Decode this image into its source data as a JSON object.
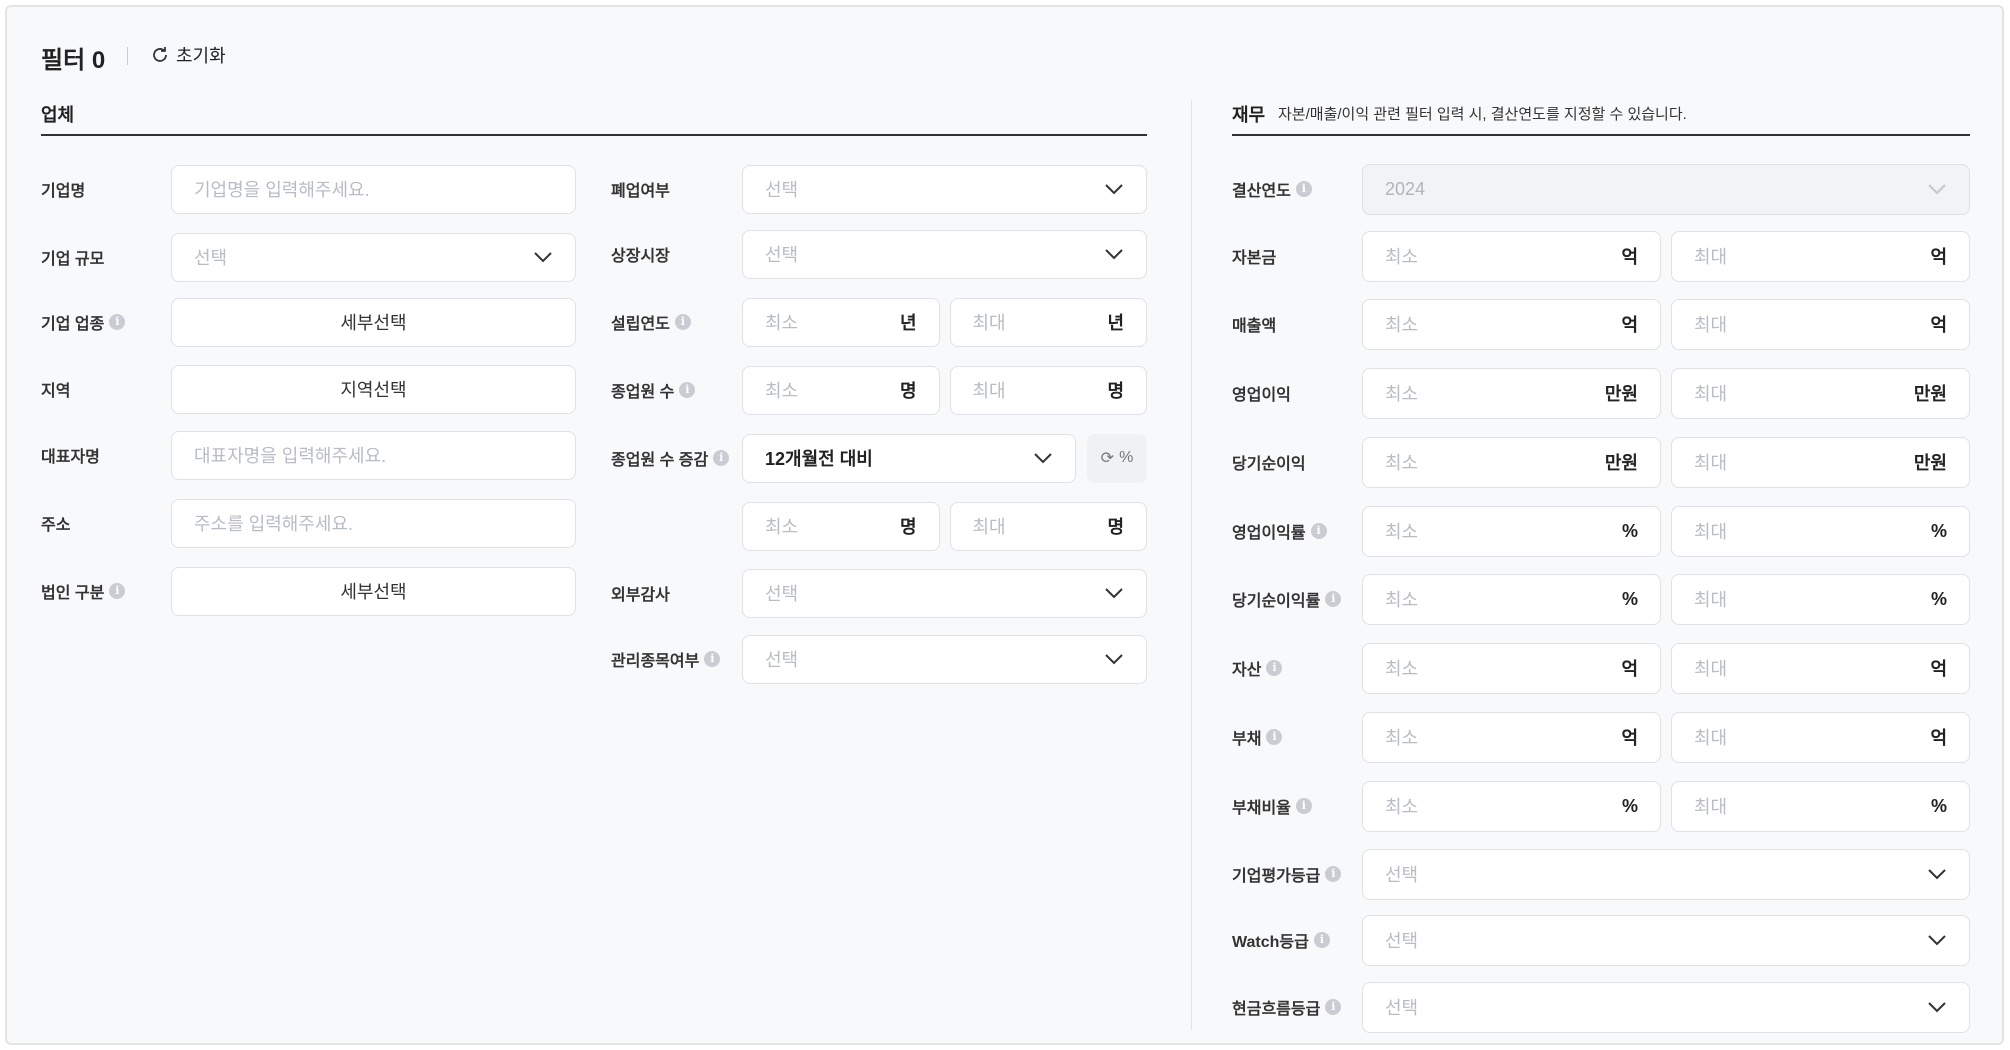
{
  "header": {
    "title": "필터 0",
    "reset_label": "초기화"
  },
  "company": {
    "title": "업체",
    "left_rows": [
      {
        "label": "기업명",
        "type": "text",
        "placeholder": "기업명을 입력해주세요."
      },
      {
        "label": "기업 규모",
        "type": "select",
        "placeholder": "선택"
      },
      {
        "label": "기업 업종",
        "info": true,
        "type": "button",
        "text": "세부선택"
      },
      {
        "label": "지역",
        "type": "button",
        "text": "지역선택"
      },
      {
        "label": "대표자명",
        "type": "text",
        "placeholder": "대표자명을 입력해주세요."
      },
      {
        "label": "주소",
        "type": "text",
        "placeholder": "주소를 입력해주세요."
      },
      {
        "label": "법인 구분",
        "info": true,
        "type": "button",
        "text": "세부선택"
      }
    ],
    "mid_rows": [
      {
        "label": "폐업여부",
        "type": "select",
        "placeholder": "선택"
      },
      {
        "label": "상장시장",
        "type": "select",
        "placeholder": "선택"
      },
      {
        "label": "설립연도",
        "info": true,
        "type": "range",
        "min": "최소",
        "max": "최대",
        "unit": "년"
      },
      {
        "label": "종업원 수",
        "info": true,
        "type": "range",
        "min": "최소",
        "max": "최대",
        "unit": "명"
      },
      {
        "label": "종업원 수 증감",
        "info": true,
        "type": "selectpct",
        "value": "12개월전 대비",
        "toggle": "%"
      },
      {
        "label": "",
        "type": "range",
        "min": "최소",
        "max": "최대",
        "unit": "명"
      },
      {
        "label": "외부감사",
        "type": "select",
        "placeholder": "선택"
      },
      {
        "label": "관리종목여부",
        "info": true,
        "type": "select",
        "placeholder": "선택"
      }
    ]
  },
  "finance": {
    "title": "재무",
    "note": "자본/매출/이익 관련 필터 입력 시, 결산연도를 지정할 수 있습니다.",
    "rows": [
      {
        "label": "결산연도",
        "info": true,
        "type": "disabled",
        "placeholder": "2024"
      },
      {
        "label": "자본금",
        "type": "range",
        "min": "최소",
        "max": "최대",
        "unit": "억"
      },
      {
        "label": "매출액",
        "type": "range",
        "min": "최소",
        "max": "최대",
        "unit": "억"
      },
      {
        "label": "영업이익",
        "type": "range",
        "min": "최소",
        "max": "최대",
        "unit": "만원"
      },
      {
        "label": "당기순이익",
        "type": "range",
        "min": "최소",
        "max": "최대",
        "unit": "만원"
      },
      {
        "label": "영업이익률",
        "info": true,
        "type": "range",
        "min": "최소",
        "max": "최대",
        "unit": "%"
      },
      {
        "label": "당기순이익률",
        "info": true,
        "type": "range",
        "min": "최소",
        "max": "최대",
        "unit": "%"
      },
      {
        "label": "자산",
        "info": true,
        "type": "range",
        "min": "최소",
        "max": "최대",
        "unit": "억"
      },
      {
        "label": "부채",
        "info": true,
        "type": "range",
        "min": "최소",
        "max": "최대",
        "unit": "억"
      },
      {
        "label": "부채비율",
        "info": true,
        "type": "range",
        "min": "최소",
        "max": "최대",
        "unit": "%"
      },
      {
        "label": "기업평가등급",
        "info": true,
        "type": "select",
        "placeholder": "선택"
      },
      {
        "label": "Watch등급",
        "info": true,
        "type": "select",
        "placeholder": "선택"
      },
      {
        "label": "현금흐름등급",
        "info": true,
        "type": "select",
        "placeholder": "선택"
      }
    ]
  }
}
